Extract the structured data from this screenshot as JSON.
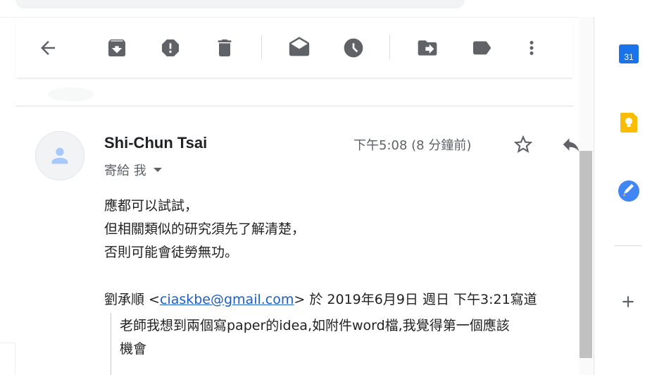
{
  "toolbar": {
    "icons": [
      "back-arrow-icon",
      "archive-icon",
      "report-spam-icon",
      "delete-icon",
      "mark-unread-icon",
      "snooze-icon",
      "move-to-icon",
      "label-icon",
      "more-vert-icon"
    ]
  },
  "message": {
    "sender": "Shi-Chun Tsai",
    "recipient": "寄給 我",
    "timestamp": "下午5:08 (8 分鐘前)",
    "body_lines": [
      "應都可以試試，",
      "但相關類似的研究須先了解清楚，",
      "否則可能會徒勞無功。"
    ],
    "quote_header_prefix": "劉承順 <",
    "quote_email": "ciaskbe@gmail.com",
    "quote_header_suffix": "> 於 2019年6月9日 週日 下午3:21寫道",
    "quoted_lines": [
      "老師我想到兩個寫paper的idea,如附件word檔,我覺得第一個應該",
      "機會"
    ]
  },
  "side_panel": {
    "calendar_day": "31",
    "apps": [
      "calendar-icon",
      "keep-icon",
      "tasks-icon",
      "add-icon"
    ]
  },
  "colors": {
    "calendar_blue": "#1a73e8",
    "keep_yellow": "#fbbc04",
    "tasks_blue": "#4285f4",
    "link_blue": "#1a5fc5"
  }
}
